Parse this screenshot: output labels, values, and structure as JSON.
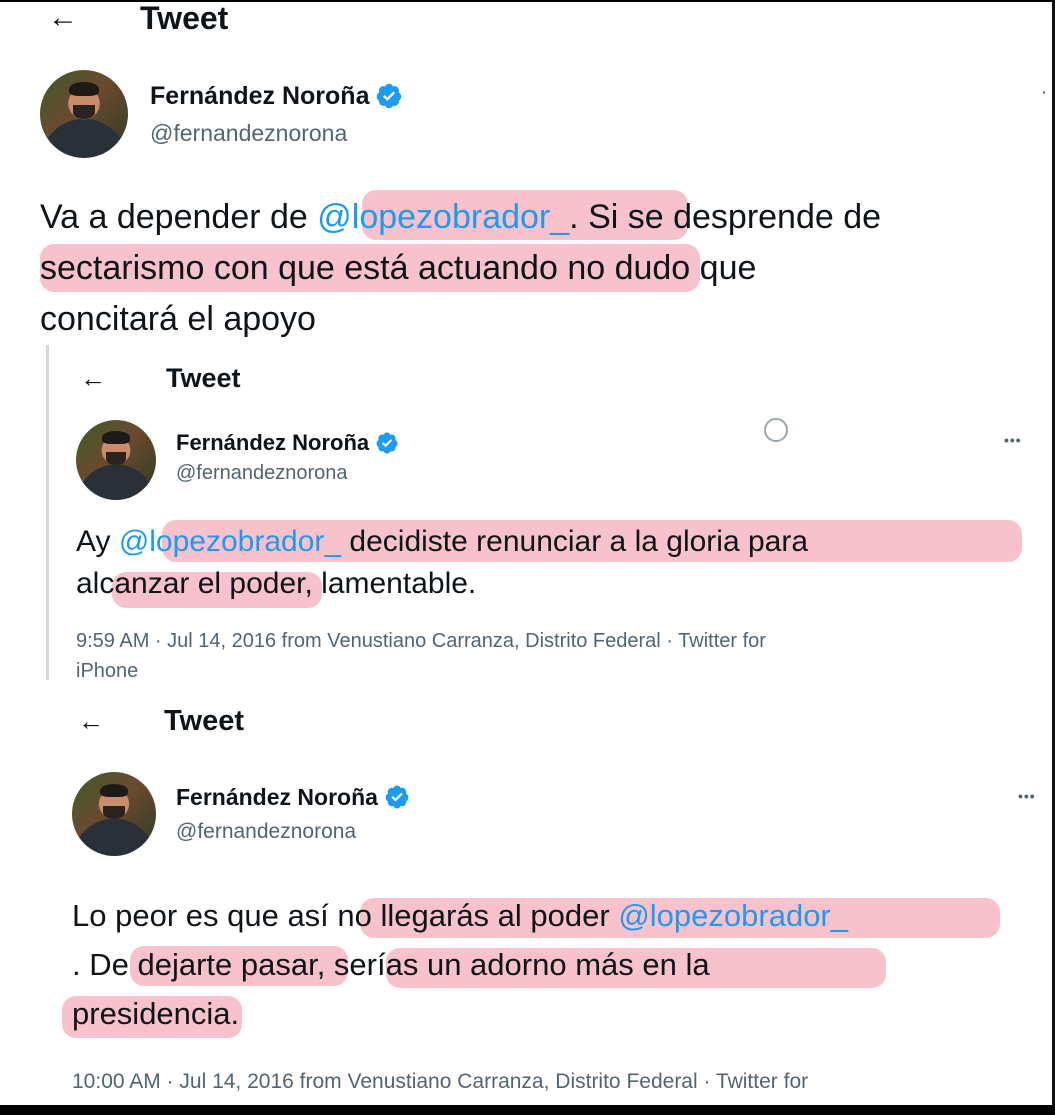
{
  "header_label": "Tweet",
  "author": {
    "name": "Fernández Noroña",
    "handle": "@fernandeznorona"
  },
  "tweets": [
    {
      "text_parts": [
        "Va a depender de ",
        "@lopezobrador_",
        ". Si se desprende de",
        "sectarismo con que está actuando no dudo que",
        "concitará el apoyo"
      ]
    },
    {
      "text_parts": [
        "Ay ",
        "@lopezobrador_",
        " decidiste renunciar a la gloria para",
        "alcanzar el poder, lamentable."
      ],
      "meta_line1": "9:59 AM · Jul 14, 2016 from Venustiano Carranza, Distrito Federal · Twitter for",
      "meta_line2": "iPhone"
    },
    {
      "text_parts": [
        "Lo peor es que así no llegarás al poder ",
        "@lopezobrador_",
        ". De dejarte pasar, serías un adorno más en la",
        "presidencia."
      ],
      "meta_line1": "10:00 AM · Jul 14, 2016 from Venustiano Carranza, Distrito Federal · Twitter for"
    }
  ],
  "icons": {
    "back": "←",
    "more": "•••"
  },
  "colors": {
    "verified": "#1d9bf0",
    "mention": "#1d9bf0",
    "highlight": "#eb6e82",
    "meta": "#536471"
  }
}
